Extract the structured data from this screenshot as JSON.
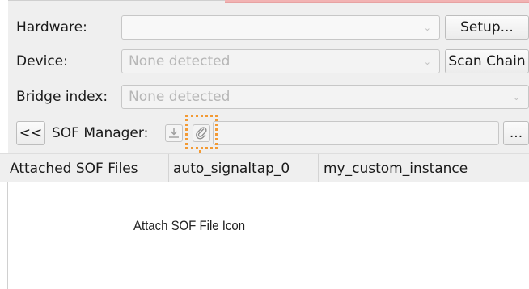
{
  "hardware": {
    "label": "Hardware:",
    "value": "",
    "setup_label": "Setup..."
  },
  "device": {
    "label": "Device:",
    "placeholder": "None detected",
    "scan_chain_label": "Scan Chain"
  },
  "bridge_index": {
    "label": "Bridge index:",
    "placeholder": "None detected"
  },
  "sof_manager": {
    "collapse_label": "<<",
    "label": "SOF Manager:",
    "program_icon": "program-device-icon",
    "attach_icon": "attach-sof-file-icon",
    "path_value": "",
    "browse_label": "..."
  },
  "table": {
    "columns": [
      "Attached SOF Files",
      "auto_signaltap_0",
      "my_custom_instance"
    ]
  },
  "annotation": {
    "callout_text": "Attach SOF File Icon",
    "color": "#f39a34"
  }
}
